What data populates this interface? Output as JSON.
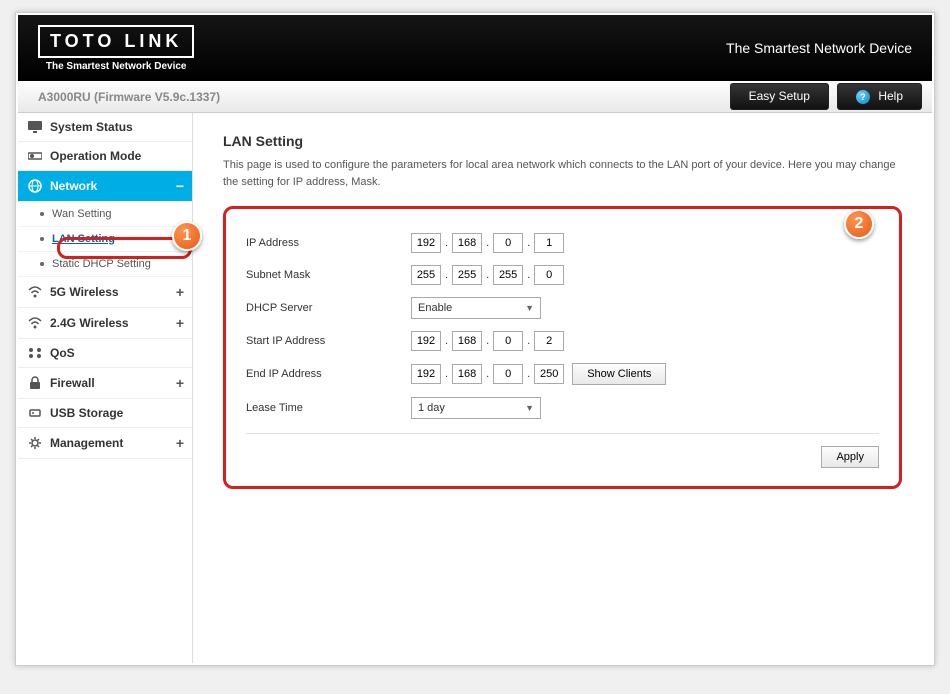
{
  "header": {
    "logo_text": "TOTO LINK",
    "logo_subtitle": "The Smartest Network Device",
    "tagline": "The Smartest Network Device"
  },
  "infobar": {
    "firmware": "A3000RU (Firmware V5.9c.1337)",
    "easy_setup_label": "Easy Setup",
    "help_label": "Help"
  },
  "sidebar": {
    "system_status": "System Status",
    "operation_mode": "Operation Mode",
    "network": "Network",
    "wan_setting": "Wan Setting",
    "lan_setting": "LAN Setting",
    "static_dhcp": "Static DHCP Setting",
    "wireless_5g": "5G Wireless",
    "wireless_24g": "2.4G Wireless",
    "qos": "QoS",
    "firewall": "Firewall",
    "usb_storage": "USB Storage",
    "management": "Management"
  },
  "main": {
    "title": "LAN Setting",
    "description": "This page is used to configure the parameters for local area network which connects to the LAN port of your device. Here you may change the setting for IP address, Mask.",
    "labels": {
      "ip_address": "IP Address",
      "subnet_mask": "Subnet Mask",
      "dhcp_server": "DHCP Server",
      "start_ip": "Start IP Address",
      "end_ip": "End IP Address",
      "lease_time": "Lease Time"
    },
    "ip_address": [
      "192",
      "168",
      "0",
      "1"
    ],
    "subnet_mask": [
      "255",
      "255",
      "255",
      "0"
    ],
    "dhcp_server": "Enable",
    "start_ip": [
      "192",
      "168",
      "0",
      "2"
    ],
    "end_ip": [
      "192",
      "168",
      "0",
      "250"
    ],
    "lease_time": "1 day",
    "show_clients_label": "Show Clients",
    "apply_label": "Apply"
  },
  "markers": {
    "m1": "1",
    "m2": "2"
  }
}
